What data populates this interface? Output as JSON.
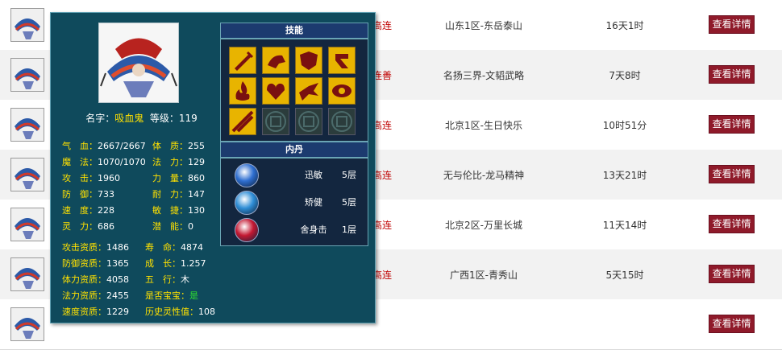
{
  "rows": [
    {
      "seller": "高连",
      "server": "山东1区-东岳泰山",
      "time": "16天1时",
      "button": "查看详情",
      "icon": "vampire-pet-icon"
    },
    {
      "seller": "连善",
      "server": "名扬三界-文韬武略",
      "time": "7天8时",
      "button": "查看详情",
      "icon": "vampire-pet-icon"
    },
    {
      "seller": "高连",
      "server": "北京1区-生日快乐",
      "time": "10时51分",
      "button": "查看详情",
      "icon": "vampire-pet-icon"
    },
    {
      "seller": "高连",
      "server": "无与伦比-龙马精神",
      "time": "13天21时",
      "button": "查看详情",
      "icon": "vampire-pet-icon"
    },
    {
      "seller": "高连",
      "server": "北京2区-万里长城",
      "time": "11天14时",
      "button": "查看详情",
      "icon": "vampire-pet-icon"
    },
    {
      "seller": "高连",
      "server": "广西1区-青秀山",
      "time": "5天15时",
      "button": "查看详情",
      "icon": "pet-icon"
    },
    {
      "seller": "",
      "server": "",
      "time": "",
      "button": "查看详情",
      "icon": "pet-icon"
    }
  ],
  "popup": {
    "name_label": "名字：",
    "name": "吸血鬼",
    "level_label": "等级：",
    "level": "119",
    "stats_left": [
      {
        "k": "气　血：",
        "v": "2667/2667"
      },
      {
        "k": "魔　法：",
        "v": "1070/1070"
      },
      {
        "k": "攻　击：",
        "v": "1960"
      },
      {
        "k": "防　御：",
        "v": "733"
      },
      {
        "k": "速　度：",
        "v": "228"
      },
      {
        "k": "灵　力：",
        "v": "686"
      }
    ],
    "stats_right": [
      {
        "k": "体　质：",
        "v": "255"
      },
      {
        "k": "法　力：",
        "v": "129"
      },
      {
        "k": "力　量：",
        "v": "860"
      },
      {
        "k": "耐　力：",
        "v": "147"
      },
      {
        "k": "敏　捷：",
        "v": "130"
      },
      {
        "k": "潜　能：",
        "v": "0"
      }
    ],
    "apt_left": [
      {
        "k": "攻击资质：",
        "v": "1486"
      },
      {
        "k": "防御资质：",
        "v": "1365"
      },
      {
        "k": "体力资质：",
        "v": "4058"
      },
      {
        "k": "法力资质：",
        "v": "2455"
      },
      {
        "k": "速度资质：",
        "v": "1229"
      }
    ],
    "apt_right": [
      {
        "k": "寿　命：",
        "v": "4874"
      },
      {
        "k": "成　长：",
        "v": "1.257"
      },
      {
        "k": "五　行：",
        "v": "木"
      },
      {
        "k": "是否宝宝：",
        "v": "是"
      },
      {
        "k": "历史灵性值：",
        "v": "108"
      }
    ],
    "skills_title": "技能",
    "skills": [
      "sword-skill-icon",
      "horse-skill-icon",
      "shield-skill-icon",
      "blood-skill-icon",
      "flame-skill-icon",
      "heart-skill-icon",
      "bird-skill-icon",
      "eye-skill-icon",
      "slash-skill-icon",
      "empty-slot-icon",
      "empty-slot-icon",
      "empty-slot-icon"
    ],
    "neidan_title": "内丹",
    "neidan": [
      {
        "name": "迅敏",
        "level": "5层",
        "icon": "swift-neidan-icon",
        "color": "#2f6fd1"
      },
      {
        "name": "矫健",
        "level": "5层",
        "icon": "agile-neidan-icon",
        "color": "#2f8ed6"
      },
      {
        "name": "舍身击",
        "level": "1层",
        "icon": "sacrifice-neidan-icon",
        "color": "#c41832"
      }
    ]
  }
}
